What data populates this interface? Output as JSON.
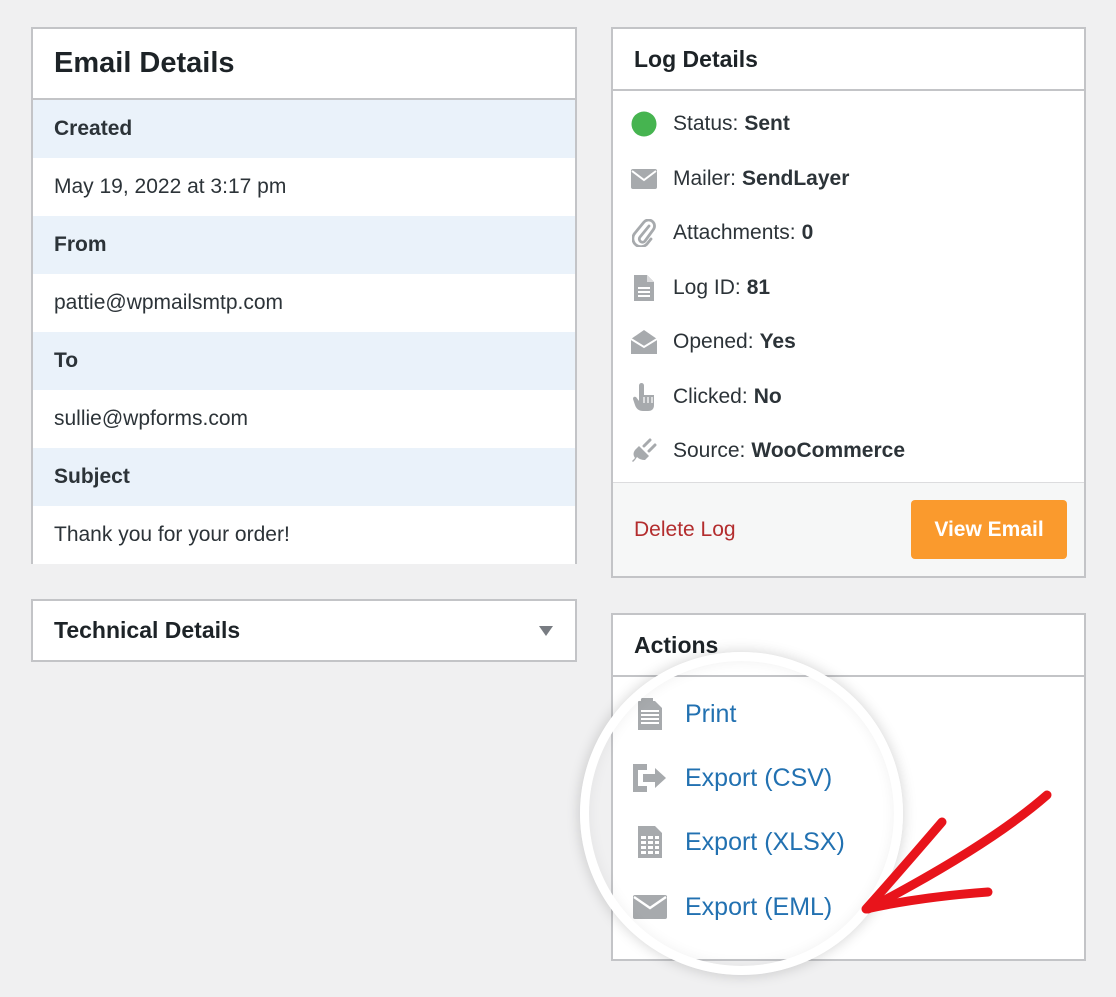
{
  "email_details": {
    "title": "Email Details",
    "fields": [
      {
        "label": "Created",
        "value": "May 19, 2022 at 3:17 pm"
      },
      {
        "label": "From",
        "value": "pattie@wpmailsmtp.com"
      },
      {
        "label": "To",
        "value": "sullie@wpforms.com"
      },
      {
        "label": "Subject",
        "value": "Thank you for your order!"
      }
    ]
  },
  "technical_details": {
    "title": "Technical Details"
  },
  "log_details": {
    "title": "Log Details",
    "rows": [
      {
        "label": "Status:",
        "value": "Sent",
        "icon": "status-dot-icon"
      },
      {
        "label": "Mailer:",
        "value": "SendLayer",
        "icon": "envelope-icon"
      },
      {
        "label": "Attachments:",
        "value": "0",
        "icon": "paperclip-icon"
      },
      {
        "label": "Log ID:",
        "value": "81",
        "icon": "document-icon"
      },
      {
        "label": "Opened:",
        "value": "Yes",
        "icon": "open-envelope-icon"
      },
      {
        "label": "Clicked:",
        "value": "No",
        "icon": "pointer-hand-icon"
      },
      {
        "label": "Source:",
        "value": "WooCommerce",
        "icon": "plug-icon"
      }
    ],
    "delete_label": "Delete Log",
    "view_label": "View Email"
  },
  "actions": {
    "title": "Actions",
    "items": [
      {
        "label": "Print",
        "icon": "print-document-icon"
      },
      {
        "label": "Export (CSV)",
        "icon": "export-arrow-icon"
      },
      {
        "label": "Export (XLSX)",
        "icon": "spreadsheet-icon"
      },
      {
        "label": "Export (EML)",
        "icon": "envelope-icon"
      }
    ]
  },
  "colors": {
    "status_green": "#46b450",
    "link_blue": "#2271b1",
    "delete_red": "#b32d2e",
    "view_button_orange": "#fa9a2d",
    "label_bg": "#eaf2fa",
    "annotation_red": "#e8141b"
  }
}
